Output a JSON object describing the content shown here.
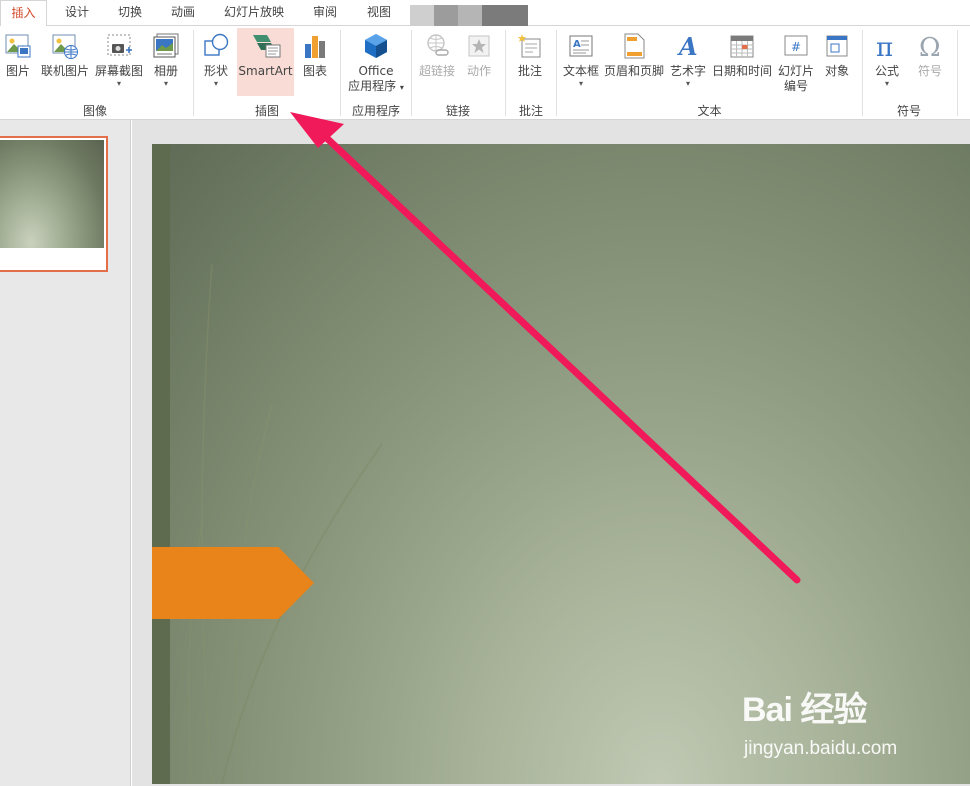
{
  "tabs": [
    {
      "label": "插入",
      "active": true
    },
    {
      "label": "设计"
    },
    {
      "label": "切换"
    },
    {
      "label": "动画"
    },
    {
      "label": "幻灯片放映"
    },
    {
      "label": "审阅"
    },
    {
      "label": "视图"
    }
  ],
  "ribbon": {
    "groups": {
      "images": "图像",
      "illustrations": "插图",
      "apps": "应用程序",
      "links": "链接",
      "comments": "批注",
      "text": "文本",
      "symbols": "符号"
    },
    "buttons": {
      "picture": "图片",
      "online_pictures": "联机图片",
      "screenshot": "屏幕截图",
      "album": "相册",
      "shapes": "形状",
      "smartart": "SmartArt",
      "chart": "图表",
      "office_apps_line1": "Office",
      "office_apps_line2": "应用程序",
      "hyperlink": "超链接",
      "action": "动作",
      "comment": "批注",
      "textbox": "文本框",
      "header_footer": "页眉和页脚",
      "wordart": "艺术字",
      "date_time": "日期和时间",
      "slide_number_line1": "幻灯片",
      "slide_number_line2": "编号",
      "object": "对象",
      "equation": "公式",
      "symbol": "符号"
    }
  },
  "watermark": {
    "logo": "Bai 经验",
    "url": "jingyan.baidu.com"
  },
  "colors": {
    "accent": "#d24726",
    "annotation_arrow": "#f0195a",
    "slide_arrow": "#e8841a",
    "smartart_highlight": "#f8dcd5"
  }
}
